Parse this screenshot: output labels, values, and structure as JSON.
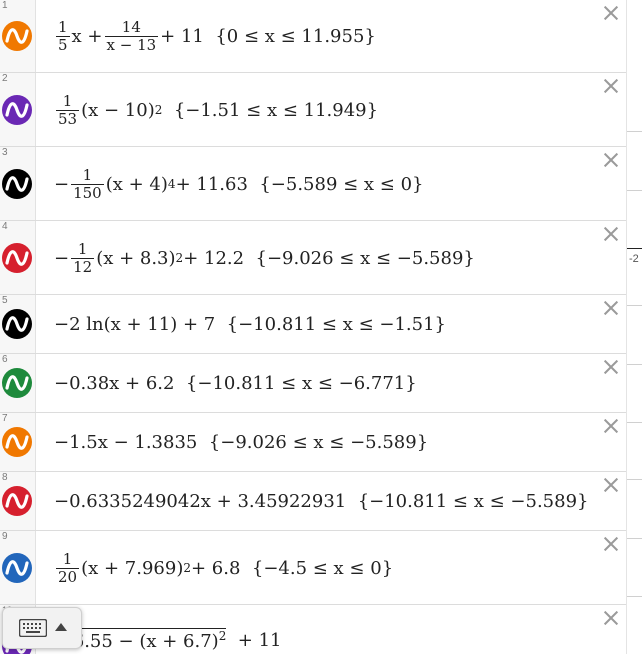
{
  "rows": [
    {
      "num": "1",
      "color": "#F07800",
      "parts": {
        "frac_num": "1",
        "frac_den": "5",
        "a": "x +",
        "frac2_num": "14",
        "frac2_den": "x − 13",
        "b": "+ 11  {0 ≤ x ≤ 11.955}"
      }
    },
    {
      "num": "2",
      "color": "#6A28B4",
      "parts": {
        "frac_num": "1",
        "frac_den": "53",
        "a": "(x − 10)",
        "sup": "2",
        "b": "  {−1.51 ≤ x ≤ 11.949}"
      }
    },
    {
      "num": "3",
      "color": "#000000",
      "parts": {
        "pre": "−",
        "frac_num": "1",
        "frac_den": "150",
        "a": "(x + 4)",
        "sup": "4",
        "b": "+ 11.63  {−5.589 ≤ x ≤ 0}"
      }
    },
    {
      "num": "4",
      "color": "#D6202E",
      "parts": {
        "pre": "−",
        "frac_num": "1",
        "frac_den": "12",
        "a": "(x + 8.3)",
        "sup": "2",
        "b": "+ 12.2  {−9.026 ≤ x ≤ −5.589}"
      }
    },
    {
      "num": "5",
      "color": "#000000",
      "text": "−2 ln(x + 11) + 7  {−10.811 ≤ x ≤ −1.51}"
    },
    {
      "num": "6",
      "color": "#1E8A3C",
      "text": "−0.38x + 6.2  {−10.811 ≤ x ≤ −6.771}"
    },
    {
      "num": "7",
      "color": "#F07800",
      "text": "−1.5x − 1.3835  {−9.026 ≤ x ≤ −5.589}"
    },
    {
      "num": "8",
      "color": "#D6202E",
      "text": "−0.6335249042x + 3.45922931  {−10.811 ≤ x ≤ −5.589}"
    },
    {
      "num": "9",
      "color": "#2266BB",
      "parts": {
        "frac_num": "1",
        "frac_den": "20",
        "a": "(x + 7.969)",
        "sup": "2",
        "b": "+ 6.8  {−4.5 ≤ x ≤ 0}"
      }
    },
    {
      "num": "10",
      "color": "#6A28B4",
      "partial": {
        "sqrt_inner": "6.55 − (x + 6.7)",
        "sup": "2",
        "b": "+ 11"
      }
    }
  ],
  "right_strip": {
    "label": "-2"
  },
  "icons": {
    "row_icon": "function-wave-icon",
    "delete": "close-icon",
    "keyboard": "keyboard-icon",
    "caret": "caret-up-icon"
  }
}
